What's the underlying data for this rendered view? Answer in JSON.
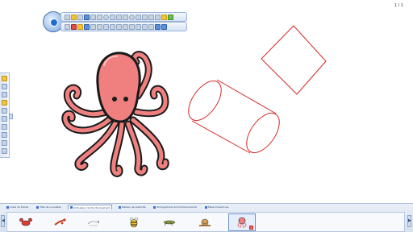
{
  "page_counter": "1 / 1",
  "gallery": {
    "tabs": [
      {
        "label": "Index de Pointe"
      },
      {
        "label": "Title de nouvelles"
      },
      {
        "label": "Ordinateur de fonctionnement",
        "active": true
      },
      {
        "label": "Bateau de publicité"
      },
      {
        "label": "Pictogramme de fonctionnement"
      },
      {
        "label": "Table d'exercices"
      }
    ],
    "items": [
      {
        "icon": "crab-icon"
      },
      {
        "icon": "lobster-icon"
      },
      {
        "icon": "bird-sketch-icon"
      },
      {
        "icon": "bee-icon"
      },
      {
        "icon": "grasshopper-icon"
      },
      {
        "icon": "snail-icon"
      },
      {
        "icon": "octopus-icon",
        "selected": true
      }
    ],
    "nav_left": "◀",
    "nav_right": "▶",
    "delete_label": "×"
  },
  "colors": {
    "octopus_fill": "#f08080",
    "octopus_outline": "#1a1a1a",
    "shape_stroke": "#d62828",
    "toolbar_accent": "#1c6fd1"
  }
}
